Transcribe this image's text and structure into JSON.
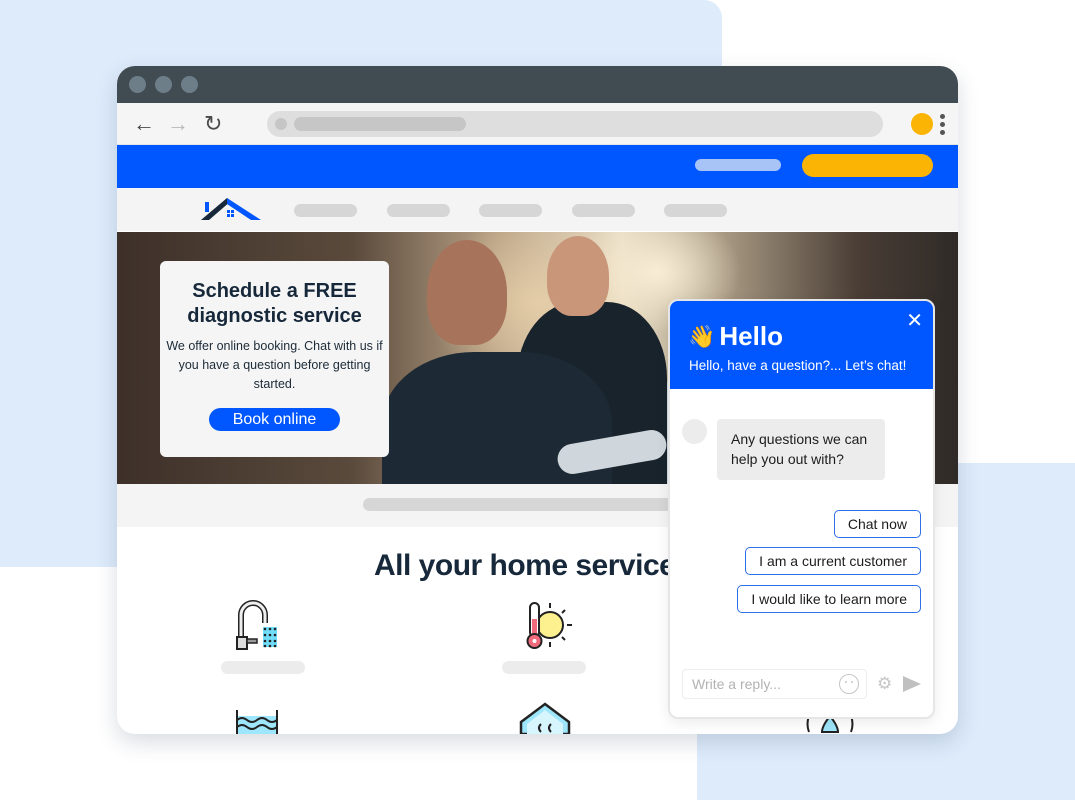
{
  "colors": {
    "brand_blue": "#0157ff",
    "accent_yellow": "#fcb404",
    "titlebar": "#414b52",
    "background_blob": "#ddebfb",
    "heading_text": "#16283a"
  },
  "browser": {
    "nav_icons": {
      "back": "arrow-left-icon",
      "forward": "arrow-right-icon",
      "reload": "reload-icon"
    }
  },
  "hero": {
    "promo": {
      "title": "Schedule a FREE diagnostic service",
      "body": "We offer online booking. Chat with us if you have a question before getting started.",
      "button_label": "Book online"
    }
  },
  "services": {
    "heading": "All your home service n",
    "icons": [
      "faucet-icon",
      "thermometer-sun-icon",
      "water-tank-icon",
      "house-humidity-icon",
      "water-drop-icon"
    ]
  },
  "chat": {
    "title": "Hello",
    "wave_emoji": "👋",
    "subtitle": "Hello, have a question?... Let’s chat!",
    "close_glyph": "✕",
    "message": "Any questions we can help you out with?",
    "quick_replies": [
      "Chat now",
      "I am a current customer",
      "I would like to learn more"
    ],
    "reply_placeholder": "Write a reply...",
    "gear_glyph": "⚙"
  }
}
